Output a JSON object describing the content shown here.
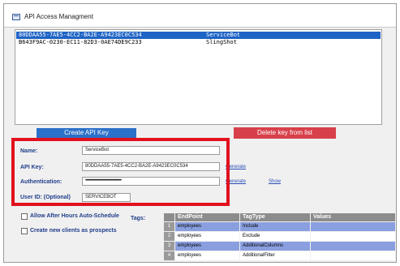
{
  "window": {
    "title": "API Access Managment"
  },
  "key_list": {
    "rows": [
      {
        "id": "80DDAA55-7AE5-4CC2-BA2E-A9423EC0C534",
        "name": "ServiceBot",
        "selected": true
      },
      {
        "id": "B643F9AC-0230-EC11-82D3-0AE74DE9C233",
        "name": "SlingShot",
        "selected": false
      }
    ]
  },
  "buttons": {
    "create": "Create API Key",
    "delete": "Delete key from list"
  },
  "form": {
    "name_label": "Name:",
    "name_value": "ServiceBot",
    "api_key_label": "API Key:",
    "api_key_value": "80DDAA55-7AE5-4CC2-BA2E-A9423EC0C534",
    "auth_label": "Authentication:",
    "auth_value": "••••••••••••••••••••••••••••••••••••••••",
    "user_id_label": "User ID: (Optional)",
    "user_id_value": "SERVICEBOT",
    "generate_link_1": "Generate",
    "generate_link_2": "Generate",
    "show_link": "Show"
  },
  "options": {
    "after_hours": "Allow After Hours Auto-Schedule",
    "new_clients": "Create new clients as prospects"
  },
  "tags": {
    "label": "Tags:",
    "columns": [
      "EndPoint",
      "TagType",
      "Values"
    ],
    "rows": [
      {
        "num": "1",
        "endpoint": "employees",
        "tagtype": "Include",
        "values": ""
      },
      {
        "num": "2",
        "endpoint": "employees",
        "tagtype": "Exclude",
        "values": ""
      },
      {
        "num": "3",
        "endpoint": "employees",
        "tagtype": "AdditionalColumns",
        "values": ""
      },
      {
        "num": "4",
        "endpoint": "employees",
        "tagtype": "AdditionalFilter",
        "values": ""
      }
    ]
  },
  "colors": {
    "selection": "#1e63c6",
    "create_button": "#2b70c9",
    "delete_button": "#d7404a",
    "highlight_box": "#e2111d",
    "label_text": "#1f3d8a"
  }
}
